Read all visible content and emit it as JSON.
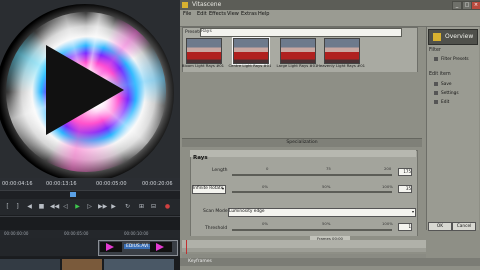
{
  "nle": {
    "timecodes": [
      "00:00:04:16",
      "00:00:13:16",
      "00:00:05:00",
      "00:00:20:06"
    ],
    "ruler_labels": [
      "00:00:00:00",
      "00:00:05:00",
      "00:00:10:00"
    ],
    "clip_label": "EDIUS.AVI..."
  },
  "vitascene": {
    "title": "Vitascene",
    "menu": [
      "File",
      "Edit",
      "Effects",
      "View",
      "Extras",
      "Help"
    ],
    "presets_label": "Presets",
    "filter_value": "Rays",
    "presets": [
      {
        "label": "Bloom Light Rays #01",
        "selected": false
      },
      {
        "label": "Centre Light Rays #01",
        "selected": true
      },
      {
        "label": "Large Light Rays #01",
        "selected": false
      },
      {
        "label": "Heavenly Light Rays #01",
        "selected": false
      }
    ],
    "sidebar": {
      "overview": "Overview",
      "filter_heading": "Filter",
      "filter_button": "Filter Presets",
      "user_heading": "Edit item",
      "buttons": [
        "Save",
        "Settings",
        "Edit"
      ]
    },
    "section_title": "Specialization",
    "params_title": "Rays",
    "params": {
      "length_label": "Length",
      "length_ticks": [
        "0",
        "75",
        "200"
      ],
      "color_dropdown": "Infinite Rotate",
      "color_ticks": [
        "0%",
        "50%",
        "100%"
      ],
      "scan_mode_label": "Scan Mode",
      "scan_mode_value": "Luminosity edge",
      "threshold_label": "Threshold",
      "threshold_ticks": [
        "0%",
        "50%",
        "100%"
      ],
      "num_values": [
        "175",
        "35",
        "1",
        "25"
      ]
    },
    "timecode": "Frames 00:00",
    "ok": "OK",
    "cancel": "Cancel",
    "status": "Keyframes"
  },
  "colors": {
    "accent_blue": "#3b6fb5",
    "magenta": "#e23ad0",
    "vitascene_gold": "#d8b130"
  }
}
